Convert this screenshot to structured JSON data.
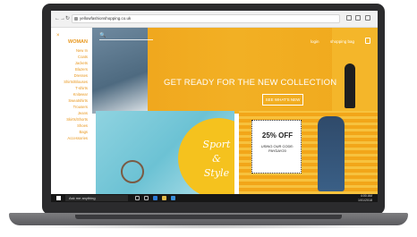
{
  "browser": {
    "url": "yellowfashionshopping.co.uk",
    "back": "←",
    "forward": "→",
    "refresh": "↻"
  },
  "sidebar": {
    "close": "×",
    "title": "WOMAN",
    "items": [
      "New In",
      "Coats",
      "Jackets",
      "Blazers",
      "Dresses",
      "Shirts/Blouses",
      "T-shirts",
      "Knitwear",
      "Sweatshirts",
      "Trousers",
      "Jeans",
      "Skirts/Shorts",
      "Shoes",
      "Bags",
      "Accessories"
    ]
  },
  "hero": {
    "search_icon": "🔍",
    "login": "login",
    "bag": "shopping bag",
    "headline": "GET READY FOR THE NEW COLLECTION",
    "cta": "SEE WHAT'S NEW"
  },
  "promo": {
    "left_line1": "Sport",
    "left_line2": "&",
    "left_line3": "Style",
    "sale_title": "25% OFF",
    "sale_sub": "USING OUR CODE: PAYDAY20"
  },
  "taskbar": {
    "search": "Ask me anything",
    "time": "4:00 AM",
    "date": "1/01/2018"
  }
}
